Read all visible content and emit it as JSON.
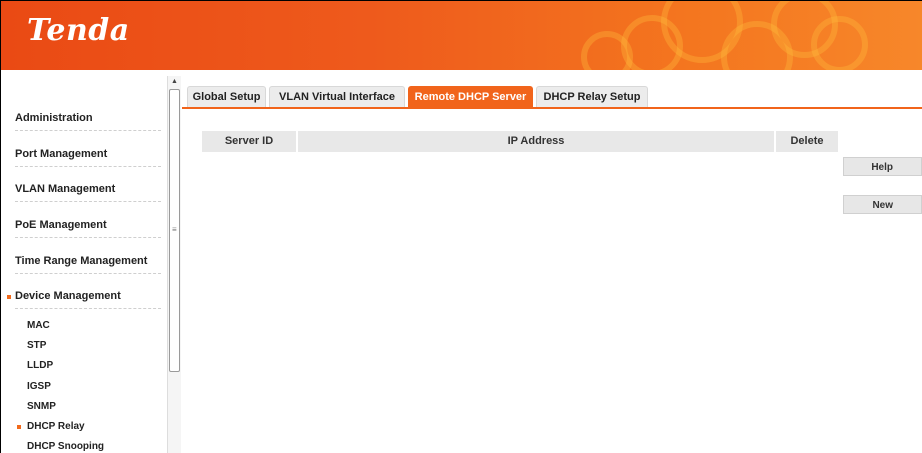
{
  "header": {
    "logo": "Tenda"
  },
  "sidebar": {
    "menu": [
      {
        "label": "Administration"
      },
      {
        "label": "Port Management"
      },
      {
        "label": "VLAN Management"
      },
      {
        "label": "PoE Management"
      },
      {
        "label": "Time Range Management"
      },
      {
        "label": "Device Management"
      }
    ],
    "submenu": [
      {
        "label": "MAC"
      },
      {
        "label": "STP"
      },
      {
        "label": "LLDP"
      },
      {
        "label": "IGSP"
      },
      {
        "label": "SNMP"
      },
      {
        "label": "DHCP Relay"
      },
      {
        "label": "DHCP Snooping"
      }
    ]
  },
  "tabs": [
    {
      "label": "Global Setup"
    },
    {
      "label": "VLAN Virtual Interface"
    },
    {
      "label": "Remote DHCP Server",
      "active": true
    },
    {
      "label": "DHCP Relay Setup"
    }
  ],
  "table": {
    "columns": [
      "Server ID",
      "IP Address",
      "Delete"
    ],
    "rows": []
  },
  "buttons": {
    "help": "Help",
    "new": "New"
  },
  "colors": {
    "accent": "#f1641b",
    "header_start": "#ea4a14",
    "header_end": "#f7872a"
  }
}
